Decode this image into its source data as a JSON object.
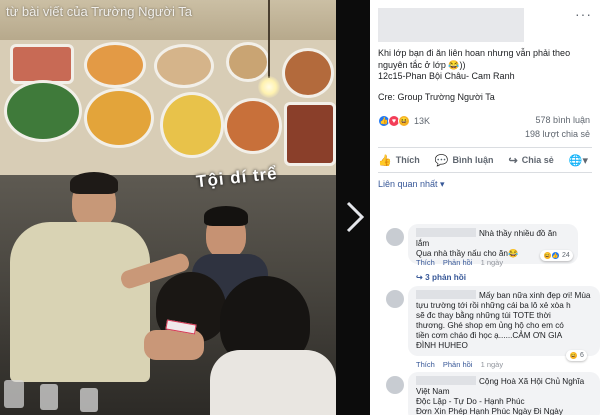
{
  "viewer": {
    "watermark": "từ bài viết của Trường Người Ta",
    "sticker_text": "Tội dí trể",
    "next_icon": "chevron-right-icon"
  },
  "post": {
    "more_label": "···",
    "lines": [
      "Khi lớp bạn đi ăn liên hoan nhưng vẫn phải theo",
      "nguyên tắc ở lớp 😂))",
      "12c15-Phan Bội Châu- Cam Ranh"
    ],
    "credit": "Cre: Group Trường Người Ta"
  },
  "stats": {
    "reaction_count": "13K",
    "comments": "578 bình luận",
    "shares": "198 lượt chia sẻ",
    "reaction_icons": [
      "like-icon",
      "heart-icon",
      "haha-icon"
    ]
  },
  "actions": {
    "like": "Thích",
    "comment": "Bình luận",
    "share": "Chia sẻ",
    "like_icon": "thumbs-up-icon",
    "comment_icon": "speech-bubble-icon",
    "share_icon": "share-arrow-icon",
    "menu_icon": "globe-dropdown-icon"
  },
  "filter": {
    "label": "Liên quan nhất ▾"
  },
  "comments": [
    {
      "text_after_name": "Nhà thầy nhiều đồ ăn lắm",
      "text_line2": "Qua nhà thầy nấu cho ăn😂",
      "meta_like": "Thích",
      "meta_reply": "Phản hồi",
      "meta_time": "1 ngày",
      "reaction_count": "24",
      "replies": "↪ 3 phản hồi"
    },
    {
      "text_after_name": "Mấy ban nữa xinh đẹp ơi! Mùa",
      "text_lines": [
        "tựu trường tới rồi những cái ba lô xẻ xòa h",
        "sẽ đc thay bằng những túi TOTE thời",
        "thương. Ghé shop em ủng hộ cho em có",
        "tiền cơm cháo đi học ạ......CẢM ƠN GIA",
        "ĐÌNH HUHEO"
      ],
      "meta_like": "Thích",
      "meta_reply": "Phản hồi",
      "meta_time": "1 ngày",
      "reaction_count": "6"
    },
    {
      "text_after_name": "Cộng Hoà Xã Hội Chủ Nghĩa",
      "text_lines": [
        "Việt Nam",
        "Độc Lập - Tự Do - Hạnh Phúc",
        "Đơn Xin Phép Hạnh Phúc Ngày Đi Ngày"
      ]
    }
  ]
}
